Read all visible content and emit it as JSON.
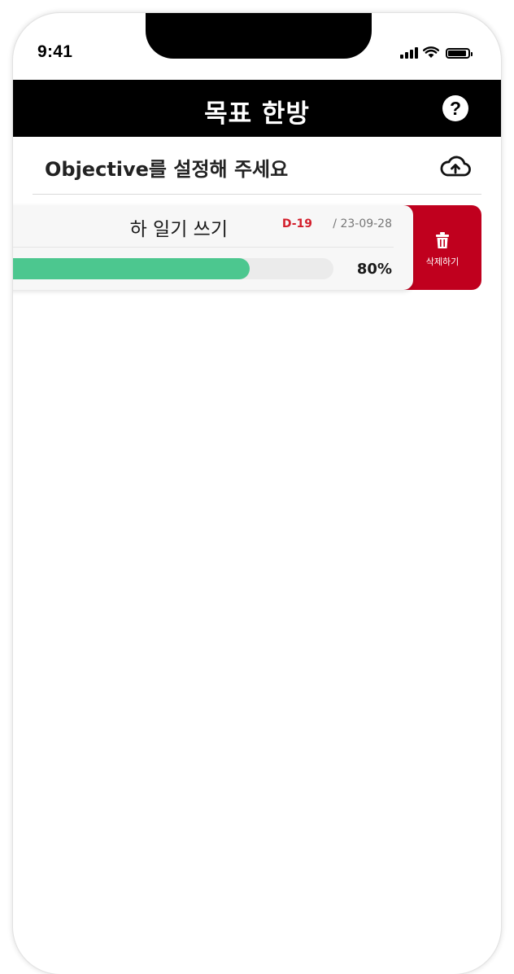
{
  "status_bar": {
    "time": "9:41"
  },
  "app_bar": {
    "title": "목표 한방",
    "help_symbol": "?"
  },
  "objective": {
    "prompt": "Objective를 설정해 주세요",
    "upload_icon": "cloud-upload-icon"
  },
  "goals": [
    {
      "title": "하 일기 쓰기",
      "dday": "D-19",
      "date": "/ 23-09-28",
      "progress": 0.8,
      "progress_label": "80%",
      "delete_label": "삭제하기"
    }
  ],
  "colors": {
    "app_bar": "#000000",
    "delete": "#c0001e",
    "dday": "#d31f2c",
    "progress": "#4cc78f",
    "track": "#ebebeb"
  }
}
